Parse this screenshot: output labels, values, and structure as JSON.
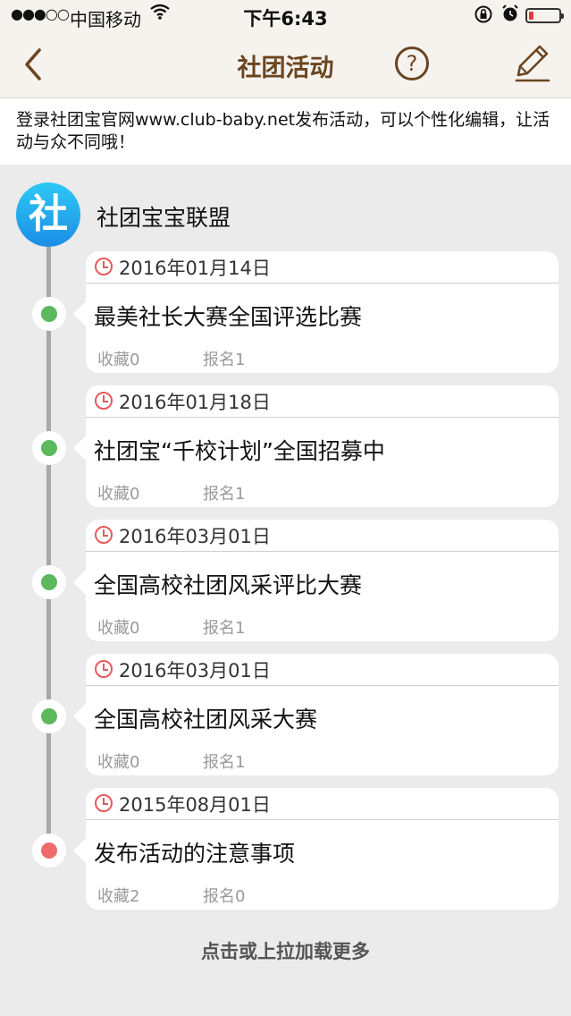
{
  "status_bar": {
    "signal": "●●●○○",
    "carrier": "中国移动",
    "time": "下午6:43",
    "battery_level": 0.15
  },
  "nav": {
    "title": "社团活动"
  },
  "notice": {
    "text": "登录社团宝官网www.club-baby.net发布活动，可以个性化编辑，让活动与众不同哦！"
  },
  "club": {
    "logo_char": "社",
    "name": "社团宝宝联盟"
  },
  "activities": [
    {
      "date": "2016年01月14日",
      "title": "最美社长大赛全国评选比赛",
      "favorites": "收藏0",
      "registrations": "报名1",
      "status_color": "#5cb85c"
    },
    {
      "date": "2016年01月18日",
      "title": "社团宝“千校计划”全国招募中",
      "favorites": "收藏0",
      "registrations": "报名1",
      "status_color": "#5cb85c"
    },
    {
      "date": "2016年03月01日",
      "title": "全国高校社团风采评比大赛",
      "favorites": "收藏0",
      "registrations": "报名1",
      "status_color": "#5cb85c"
    },
    {
      "date": "2016年03月01日",
      "title": "全国高校社团风采大赛",
      "favorites": "收藏0",
      "registrations": "报名1",
      "status_color": "#5cb85c"
    },
    {
      "date": "2015年08月01日",
      "title": "发布活动的注意事项",
      "favorites": "收藏2",
      "registrations": "报名0",
      "status_color": "#ee6b6b"
    }
  ],
  "load_more": "点击或上拉加载更多",
  "colors": {
    "accent": "#6b4520",
    "nav_bg": "#f6f3ee",
    "page_bg": "#ebebeb",
    "clock_red": "#e35b5b"
  },
  "icons": [
    "back-chevron-icon",
    "help-circle-icon",
    "edit-pencil-icon",
    "clock-icon",
    "wifi-icon",
    "lock-rotation-icon",
    "alarm-icon",
    "battery-icon"
  ]
}
